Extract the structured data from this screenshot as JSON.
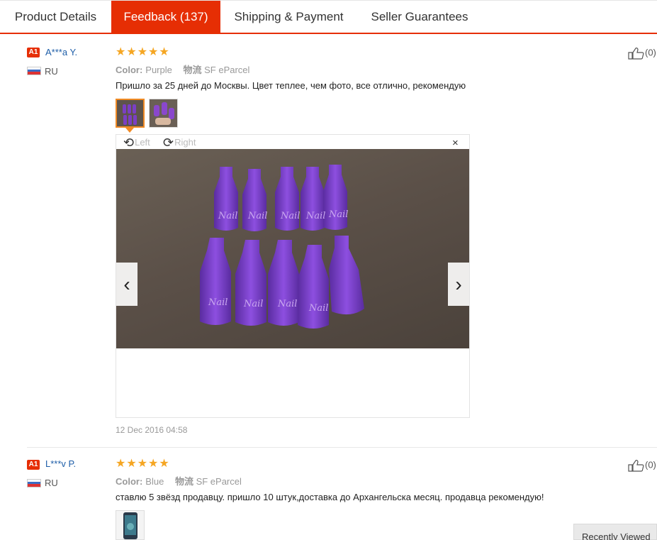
{
  "tabs": [
    {
      "label": "Product Details"
    },
    {
      "label": "Feedback (137)"
    },
    {
      "label": "Shipping & Payment"
    },
    {
      "label": "Seller Guarantees"
    }
  ],
  "reviews": [
    {
      "badge": "A1",
      "user": "A***a Y.",
      "country": "RU",
      "stars": "★★★★★",
      "rating": 5,
      "color_label": "Color:",
      "color_value": "Purple",
      "logistics_label": "物流",
      "logistics_value": "SF eParcel",
      "text": "Пришло за 25 дней до Москвы. Цвет теплее, чем фото, все отлично, рекомендую",
      "likes": "(0)",
      "date": "12 Dec 2016 04:58"
    },
    {
      "badge": "A1",
      "user": "L***v P.",
      "country": "RU",
      "stars": "★★★★★",
      "rating": 5,
      "color_label": "Color:",
      "color_value": "Blue",
      "logistics_label": "物流",
      "logistics_value": "SF eParcel",
      "text": "ставлю 5 звёзд продавцу. пришло 10 штук,доставка до Архангельска месяц. продавца рекомендую!",
      "likes": "(0)"
    }
  ],
  "viewer": {
    "rotate_left": "Left",
    "rotate_right": "Right",
    "close": "×",
    "prev": "‹",
    "next": "›",
    "rotate_left_icon": "rotate-left-icon",
    "rotate_right_icon": "rotate-right-icon"
  },
  "recently_viewed": "Recently Viewed",
  "colors": {
    "accent": "#e62e04",
    "star": "#f5a623",
    "link": "#1e5ea8",
    "thumb_select": "#f08a24"
  }
}
